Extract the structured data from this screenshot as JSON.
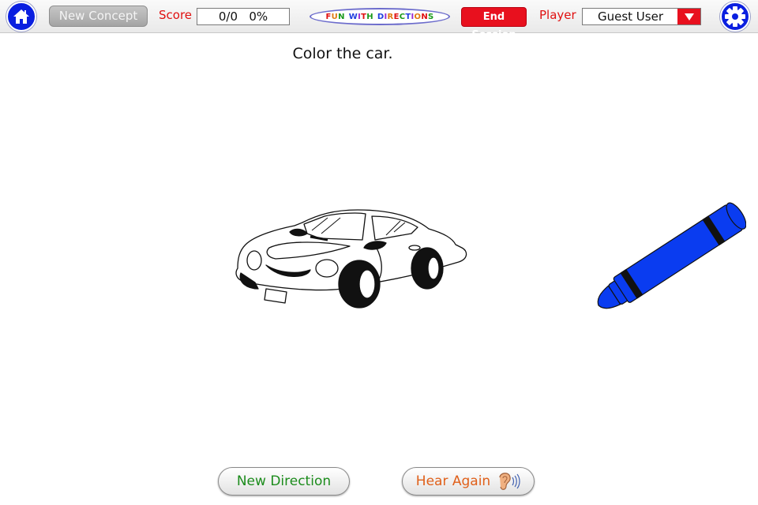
{
  "toolbar": {
    "home_icon": "home-icon",
    "new_concept_label": "New Concept",
    "score_label": "Score",
    "score_value": "0/0   0%",
    "logo_letters": [
      {
        "t": "F",
        "c": "#e01010"
      },
      {
        "t": "U",
        "c": "#e07a10"
      },
      {
        "t": "N",
        "c": "#1a9a1a"
      },
      {
        "t": " ",
        "c": "#000000"
      },
      {
        "t": "W",
        "c": "#2040e0"
      },
      {
        "t": "I",
        "c": "#9a2ad0"
      },
      {
        "t": "T",
        "c": "#e01010"
      },
      {
        "t": "H",
        "c": "#1a9a1a"
      },
      {
        "t": " ",
        "c": "#000000"
      },
      {
        "t": "D",
        "c": "#2040e0"
      },
      {
        "t": "I",
        "c": "#9a2ad0"
      },
      {
        "t": "R",
        "c": "#e07a10"
      },
      {
        "t": "E",
        "c": "#e01010"
      },
      {
        "t": "C",
        "c": "#1a9a1a"
      },
      {
        "t": "T",
        "c": "#2040e0"
      },
      {
        "t": "I",
        "c": "#9a2ad0"
      },
      {
        "t": "O",
        "c": "#e07a10"
      },
      {
        "t": "N",
        "c": "#e01010"
      },
      {
        "t": "S",
        "c": "#1a9a1a"
      }
    ],
    "logo_text": "FUN WITH DIRECTIONS",
    "end_session_label": "End Session",
    "player_label": "Player",
    "player_value": "Guest User",
    "settings_icon": "gear-icon"
  },
  "main": {
    "direction_text": "Color the car.",
    "picture": "car",
    "tool": {
      "type": "crayon",
      "color": "#0a3cf0"
    }
  },
  "footer": {
    "new_direction_label": "New Direction",
    "hear_again_label": "Hear Again"
  },
  "colors": {
    "brand_blue": "#0a1fe0",
    "alert_red": "#e8101e",
    "label_red": "#e01010",
    "new_direction_green": "#1c8c1c",
    "hear_again_orange": "#e0601a"
  }
}
